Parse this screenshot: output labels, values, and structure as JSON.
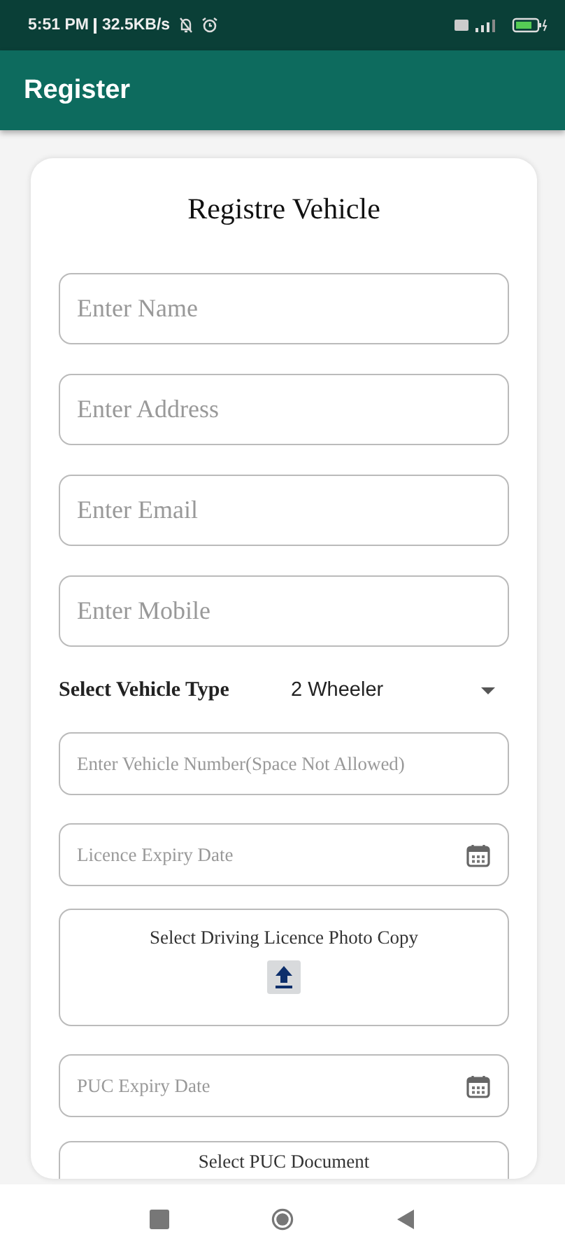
{
  "status_bar": {
    "time": "5:51 PM",
    "speed": "32.5KB/s"
  },
  "app_bar": {
    "title": "Register"
  },
  "form": {
    "title": "Registre Vehicle",
    "fields": [
      {
        "kind": "text",
        "placeholder": "Enter Name"
      },
      {
        "kind": "text",
        "placeholder": "Enter Address"
      },
      {
        "kind": "text",
        "placeholder": "Enter Email"
      },
      {
        "kind": "text",
        "placeholder": "Enter Mobile"
      },
      {
        "kind": "select",
        "label": "Select Vehicle Type",
        "value": "2 Wheeler"
      },
      {
        "kind": "small",
        "placeholder": "Enter Vehicle Number(Space Not Allowed)"
      },
      {
        "kind": "date",
        "placeholder": "Licence Expiry Date"
      },
      {
        "kind": "upload",
        "label": "Select Driving Licence Photo Copy"
      },
      {
        "kind": "date",
        "placeholder": "PUC Expiry Date"
      },
      {
        "kind": "upload_top",
        "label": "Select PUC Document"
      }
    ]
  }
}
